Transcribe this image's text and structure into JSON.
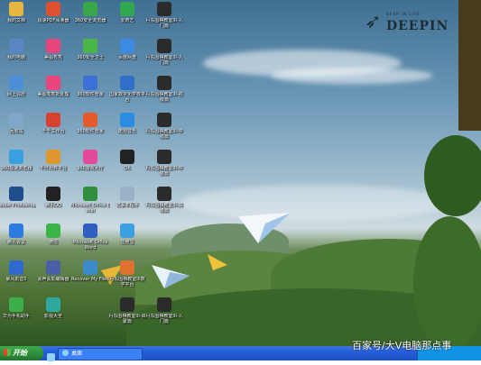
{
  "desktop": {
    "logo": {
      "small_text": "DEEP IN LIFE",
      "name": "DEEPIN"
    },
    "icons": [
      {
        "label": "我的文档",
        "icon": "folder-icon",
        "color": "#e6b640"
      },
      {
        "label": "极速PDF阅读器",
        "icon": "pdf-icon",
        "color": "#e0502f"
      },
      {
        "label": "360安全浏览器",
        "icon": "browser-icon",
        "color": "#3aa64a"
      },
      {
        "label": "爱奇艺",
        "icon": "video-icon",
        "color": "#2fa84f"
      },
      {
        "label": "丹东围棋教室III-入门篇",
        "icon": "go-icon",
        "color": "#2b2b2b"
      },
      {
        "label": "我的电脑",
        "icon": "computer-icon",
        "color": "#5b86c4"
      },
      {
        "label": "美图秀秀",
        "icon": "photo-icon",
        "color": "#e8457d"
      },
      {
        "label": "360安全卫士",
        "icon": "shield-icon",
        "color": "#4bb648"
      },
      {
        "label": "百度网盘",
        "icon": "cloud-icon",
        "color": "#3d8be0"
      },
      {
        "label": "丹东围棋教室III-入门篇",
        "icon": "go-icon",
        "color": "#2b2b2b"
      },
      {
        "label": "网上邻居",
        "icon": "network-icon",
        "color": "#4d8ed8"
      },
      {
        "label": "美图秀秀批处理",
        "icon": "photo-batch-icon",
        "color": "#e8457d"
      },
      {
        "label": "360软件管家",
        "icon": "software-icon",
        "color": "#3d6fd6"
      },
      {
        "label": "国家数字化学校平台",
        "icon": "school-icon",
        "color": "#2f6fc9"
      },
      {
        "label": "丹东围棋教室III-初级篇",
        "icon": "go-icon",
        "color": "#2b2b2b"
      },
      {
        "label": "回收站",
        "icon": "recycle-bin-icon",
        "color": "#7fa7c9"
      },
      {
        "label": "千千工作台",
        "icon": "workbench-icon",
        "color": "#d8402f"
      },
      {
        "label": "360软件管家",
        "icon": "app-store-icon",
        "color": "#e55a2b"
      },
      {
        "label": "酷狗音乐",
        "icon": "music-icon",
        "color": "#2b8de0"
      },
      {
        "label": "丹东围棋教室III-中级篇",
        "icon": "go-icon",
        "color": "#2b2b2b"
      },
      {
        "label": "360极速浏览器",
        "icon": "speed-browser-icon",
        "color": "#3a9fe0"
      },
      {
        "label": "千仟对弈平台",
        "icon": "chess-icon",
        "color": "#e0962f"
      },
      {
        "label": "360游戏大厅",
        "icon": "game-icon",
        "color": "#e34b9a"
      },
      {
        "label": "OK",
        "icon": "ok-icon",
        "color": "#222222"
      },
      {
        "label": "丹东围棋教室III-中级篇",
        "icon": "go-icon",
        "color": "#2b2b2b"
      },
      {
        "label": "Adobe Photoshop",
        "icon": "photoshop-icon",
        "color": "#1f4e8c"
      },
      {
        "label": "腾讯QQ",
        "icon": "qq-icon",
        "color": "#222222"
      },
      {
        "label": "Microsoft Office Excel",
        "icon": "excel-icon",
        "color": "#2f8f3f"
      },
      {
        "label": "记事本程序",
        "icon": "notepad-icon",
        "color": "#9ab2c8"
      },
      {
        "label": "丹东围棋教室III-高级篇",
        "icon": "go-icon",
        "color": "#2b2b2b"
      },
      {
        "label": "腾讯会议",
        "icon": "meeting-icon",
        "color": "#2b7be0"
      },
      {
        "label": "微信",
        "icon": "wechat-icon",
        "color": "#3cb548"
      },
      {
        "label": "Microsoft Office Word",
        "icon": "word-icon",
        "color": "#2f5fc0"
      },
      {
        "label": "应用宝",
        "icon": "app-icon",
        "color": "#3aa0e0"
      },
      {
        "label": "",
        "icon": "empty",
        "color": "transparent"
      },
      {
        "label": "暴风影音5",
        "icon": "storm-icon",
        "color": "#2f6ad0"
      },
      {
        "label": "会声会影编辑器",
        "icon": "edit-icon",
        "color": "#4a5fa8"
      },
      {
        "label": "Recover My Files",
        "icon": "recover-icon",
        "color": "#3c89c9"
      },
      {
        "label": "丹东围棋教室III数学平台",
        "icon": "go-icon",
        "color": "#e0702f"
      },
      {
        "label": "",
        "icon": "empty",
        "color": "transparent"
      },
      {
        "label": "华为手机助手",
        "icon": "phone-assistant-icon",
        "color": "#3cae4a"
      },
      {
        "label": "影视大全",
        "icon": "movie-icon",
        "color": "#2fa8a0"
      },
      {
        "label": "",
        "icon": "empty",
        "color": "transparent"
      },
      {
        "label": "丹东围棋教室III-启蒙篇",
        "icon": "go-icon",
        "color": "#2b2b2b"
      },
      {
        "label": "丹东围棋教室III-入门篇",
        "icon": "go-icon",
        "color": "#2b2b2b"
      }
    ]
  },
  "taskbar": {
    "start_label": "开始",
    "quick_launch": [
      {
        "icon": "ie-icon",
        "color": "#8fd2ff"
      },
      {
        "icon": "desktop-icon",
        "color": "#f0c040"
      }
    ],
    "task": {
      "label": "桌面",
      "icon": "window-icon"
    }
  },
  "watermark": "百家号/大V电脑那点事"
}
